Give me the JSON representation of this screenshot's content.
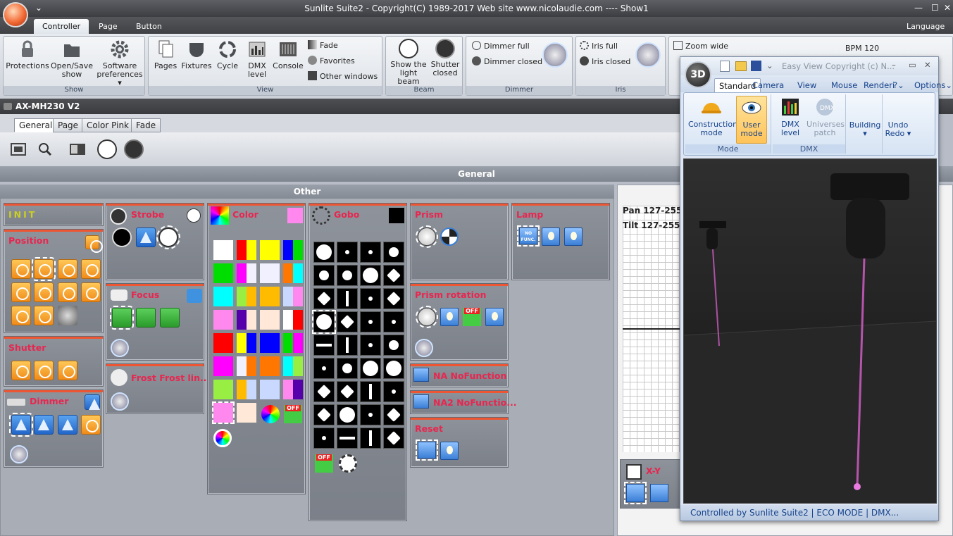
{
  "title_bar": {
    "title": "Sunlite Suite2 - Copyright(C) 1989-2017    Web site www.nicolaudie.com ---- Show1"
  },
  "menu_tabs": {
    "controller": "Controller",
    "page": "Page",
    "button": "Button",
    "language": "Language"
  },
  "ribbon": {
    "show": {
      "label": "Show",
      "protections": "Protections",
      "open_save_1": "Open/Save",
      "open_save_2": "show",
      "software_1": "Software",
      "software_2": "preferences"
    },
    "view": {
      "label": "View",
      "pages": "Pages",
      "fixtures": "Fixtures",
      "cycle": "Cycle",
      "dmx_1": "DMX",
      "dmx_2": "level",
      "console": "Console",
      "fade": "Fade",
      "favorites": "Favorites",
      "other_windows": "Other windows"
    },
    "beam": {
      "label": "Beam",
      "show_1": "Show the",
      "show_2": "light beam",
      "shutter_1": "Shutter",
      "shutter_2": "closed"
    },
    "dimmer": {
      "label": "Dimmer",
      "full": "Dimmer full",
      "closed": "Dimmer closed"
    },
    "iris": {
      "label": "Iris",
      "full": "Iris full",
      "closed": "Iris closed"
    },
    "zoom": {
      "wide": "Zoom wide"
    },
    "bpm": "BPM 120"
  },
  "fixture_title": "AX-MH230 V2",
  "fixture_tabs": [
    "General",
    "Page",
    "Color Pink",
    "Fade"
  ],
  "general_bar": "General",
  "other_bar": "Other",
  "sections": {
    "init": "INIT",
    "position": "Position",
    "shutter": "Shutter",
    "dimmer": "Dimmer",
    "strobe": "Strobe",
    "focus": "Focus",
    "frost": "Frost Frost lin...",
    "color": "Color",
    "gobo": "Gobo",
    "prism": "Prism",
    "lamp": "Lamp",
    "prism_rotation": "Prism rotation",
    "na": "NA NoFunction",
    "na2": "NA2 NoFunctio...",
    "reset": "Reset",
    "xy": "X-Y"
  },
  "nofunc_label": "NO FUNC.",
  "off_label": "OFF",
  "right_panel": {
    "pan": "Pan 127-255",
    "tilt": "Tilt 127-255"
  },
  "window_3d": {
    "logo": "3D",
    "title": "Easy View   Copyright (c) N...",
    "tabs": [
      "Standard",
      "Camera",
      "View",
      "Mouse",
      "Renderi",
      "?",
      "Options"
    ],
    "mode": {
      "label": "Mode",
      "construction_1": "Construction",
      "construction_2": "mode",
      "user_1": "User",
      "user_2": "mode"
    },
    "dmx": {
      "label": "DMX",
      "level_1": "DMX",
      "level_2": "level",
      "universes_1": "Universes",
      "universes_2": "patch"
    },
    "building": "Building",
    "undo_1": "Undo",
    "undo_2": "Redo",
    "status": "Controlled by Sunlite Suite2   |   ECO MODE   |   DMX..."
  },
  "color_swatches": [
    "#ffffff",
    "#ff0000",
    "#ffff00",
    "#0000ff",
    "#00dd00",
    "#ff00ff",
    "#f0f0ff",
    "#ff7700",
    "#00ffff",
    "#99ee44",
    "#ffbb00",
    "#c8d8ff",
    "#ff88ee",
    "#5500aa",
    "#ffe8d8"
  ],
  "colors": {
    "accent_red": "#e8264f",
    "section_bar": "#ee5533",
    "ribbon_blue": "#15428b"
  }
}
